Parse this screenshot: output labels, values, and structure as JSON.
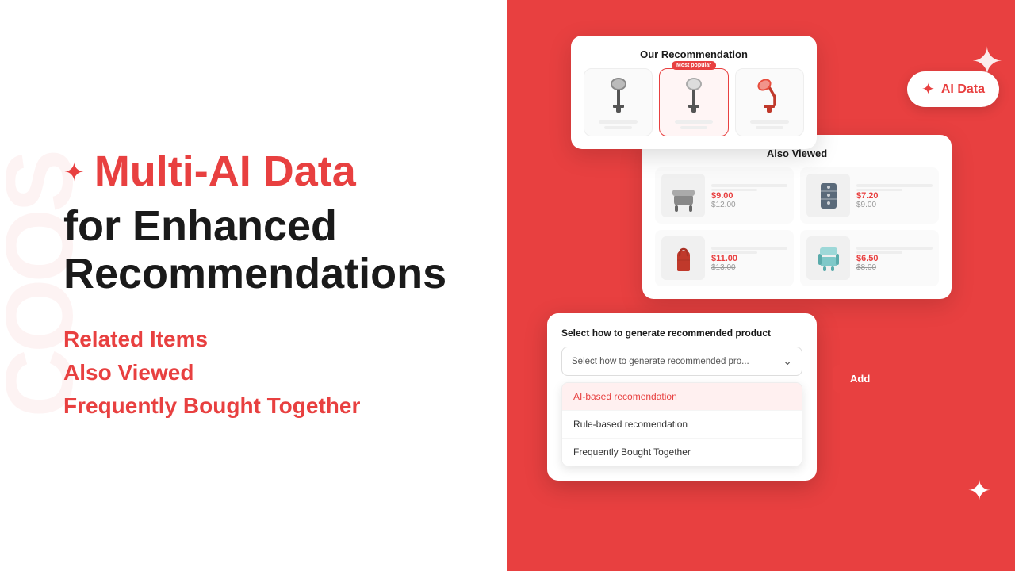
{
  "page": {
    "title": "Multi-AI Data for Enhanced Recommendations"
  },
  "left": {
    "heading_colored": "Multi-AI Data",
    "heading_black_line1": "for Enhanced",
    "heading_black_line2": "Recommendations",
    "features": [
      "Related Items",
      "Also Viewed",
      "Frequently Bought Together"
    ],
    "watermark": "COOS"
  },
  "right": {
    "ai_bubble": {
      "spark": "✦",
      "text": "AI Data"
    },
    "rec_card": {
      "title": "Our Recommendation",
      "most_popular_badge": "Most popular",
      "items": [
        {
          "lamp": "🪔",
          "selected": false
        },
        {
          "lamp": "🪔",
          "selected": true
        },
        {
          "lamp": "🪔",
          "selected": false,
          "colored": true
        }
      ]
    },
    "also_viewed_card": {
      "title": "Also Viewed",
      "items": [
        {
          "icon": "🪑",
          "price": "$9.00",
          "old_price": "$12.00"
        },
        {
          "icon": "🗄️",
          "price": "$7.20",
          "old_price": "$9.00"
        },
        {
          "icon": "👜",
          "price": "$11.00",
          "old_price": "$13.00"
        },
        {
          "icon": "🛋️",
          "price": "$6.50",
          "old_price": "$8.00"
        }
      ]
    },
    "dropdown": {
      "label": "Select how to generate recommended product",
      "placeholder": "Select how to generate recommended pro...",
      "options": [
        {
          "text": "AI-based recomendation",
          "highlighted": true
        },
        {
          "text": "Rule-based recomendation",
          "highlighted": false
        },
        {
          "text": "Frequently Bought Together",
          "highlighted": false
        }
      ]
    },
    "add_button": "Add",
    "sparkle_top_right": "✦",
    "sparkle_bottom_right": "✦"
  }
}
